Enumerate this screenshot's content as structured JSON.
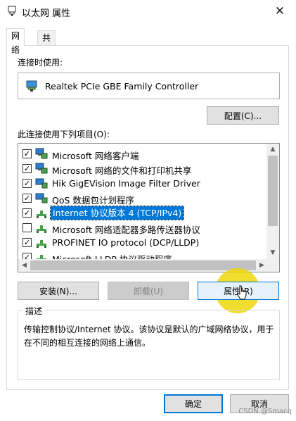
{
  "window": {
    "title": "以太网 属性",
    "close_glyph": "✕"
  },
  "tabs": [
    {
      "label": "网络",
      "active": true
    },
    {
      "label": "共享",
      "active": false
    }
  ],
  "connect_using": {
    "label": "连接时使用:",
    "adapter": "Realtek PCIe GBE Family Controller",
    "configure_button": "配置(C)..."
  },
  "items": {
    "label": "此连接使用下列项目(O):",
    "list": [
      {
        "checked": true,
        "text": "Microsoft 网络客户端",
        "icon": "network-client-icon",
        "selected": false
      },
      {
        "checked": true,
        "text": "Microsoft 网络的文件和打印机共享",
        "icon": "network-client-icon",
        "selected": false
      },
      {
        "checked": true,
        "text": "Hik GigEVision Image Filter Driver",
        "icon": "network-service-icon",
        "selected": false
      },
      {
        "checked": true,
        "text": "QoS 数据包计划程序",
        "icon": "network-service-icon",
        "selected": false
      },
      {
        "checked": true,
        "text": "Internet 协议版本 4 (TCP/IPv4)",
        "icon": "protocol-icon",
        "selected": true
      },
      {
        "checked": false,
        "text": "Microsoft 网络适配器多路传送器协议",
        "icon": "protocol-icon",
        "selected": false
      },
      {
        "checked": true,
        "text": "PROFINET IO protocol (DCP/LLDP)",
        "icon": "protocol-icon",
        "selected": false
      },
      {
        "checked": true,
        "text": "Microsoft LLDP 协议驱动程序",
        "icon": "protocol-icon",
        "selected": false
      }
    ],
    "install_button": "安装(N)...",
    "uninstall_button": "卸载(U)",
    "properties_button": "属性(R)"
  },
  "description": {
    "title": "描述",
    "text": "传输控制协议/Internet 协议。该协议是默认的广域网络协议，用于在不同的相互连接的网络上通信。"
  },
  "footer": {
    "ok_button": "确定",
    "cancel_button": "取消"
  },
  "watermark": "CSDN @Smacq",
  "colors": {
    "accent": "#0078d7",
    "cursor_highlight": "#eed600"
  }
}
